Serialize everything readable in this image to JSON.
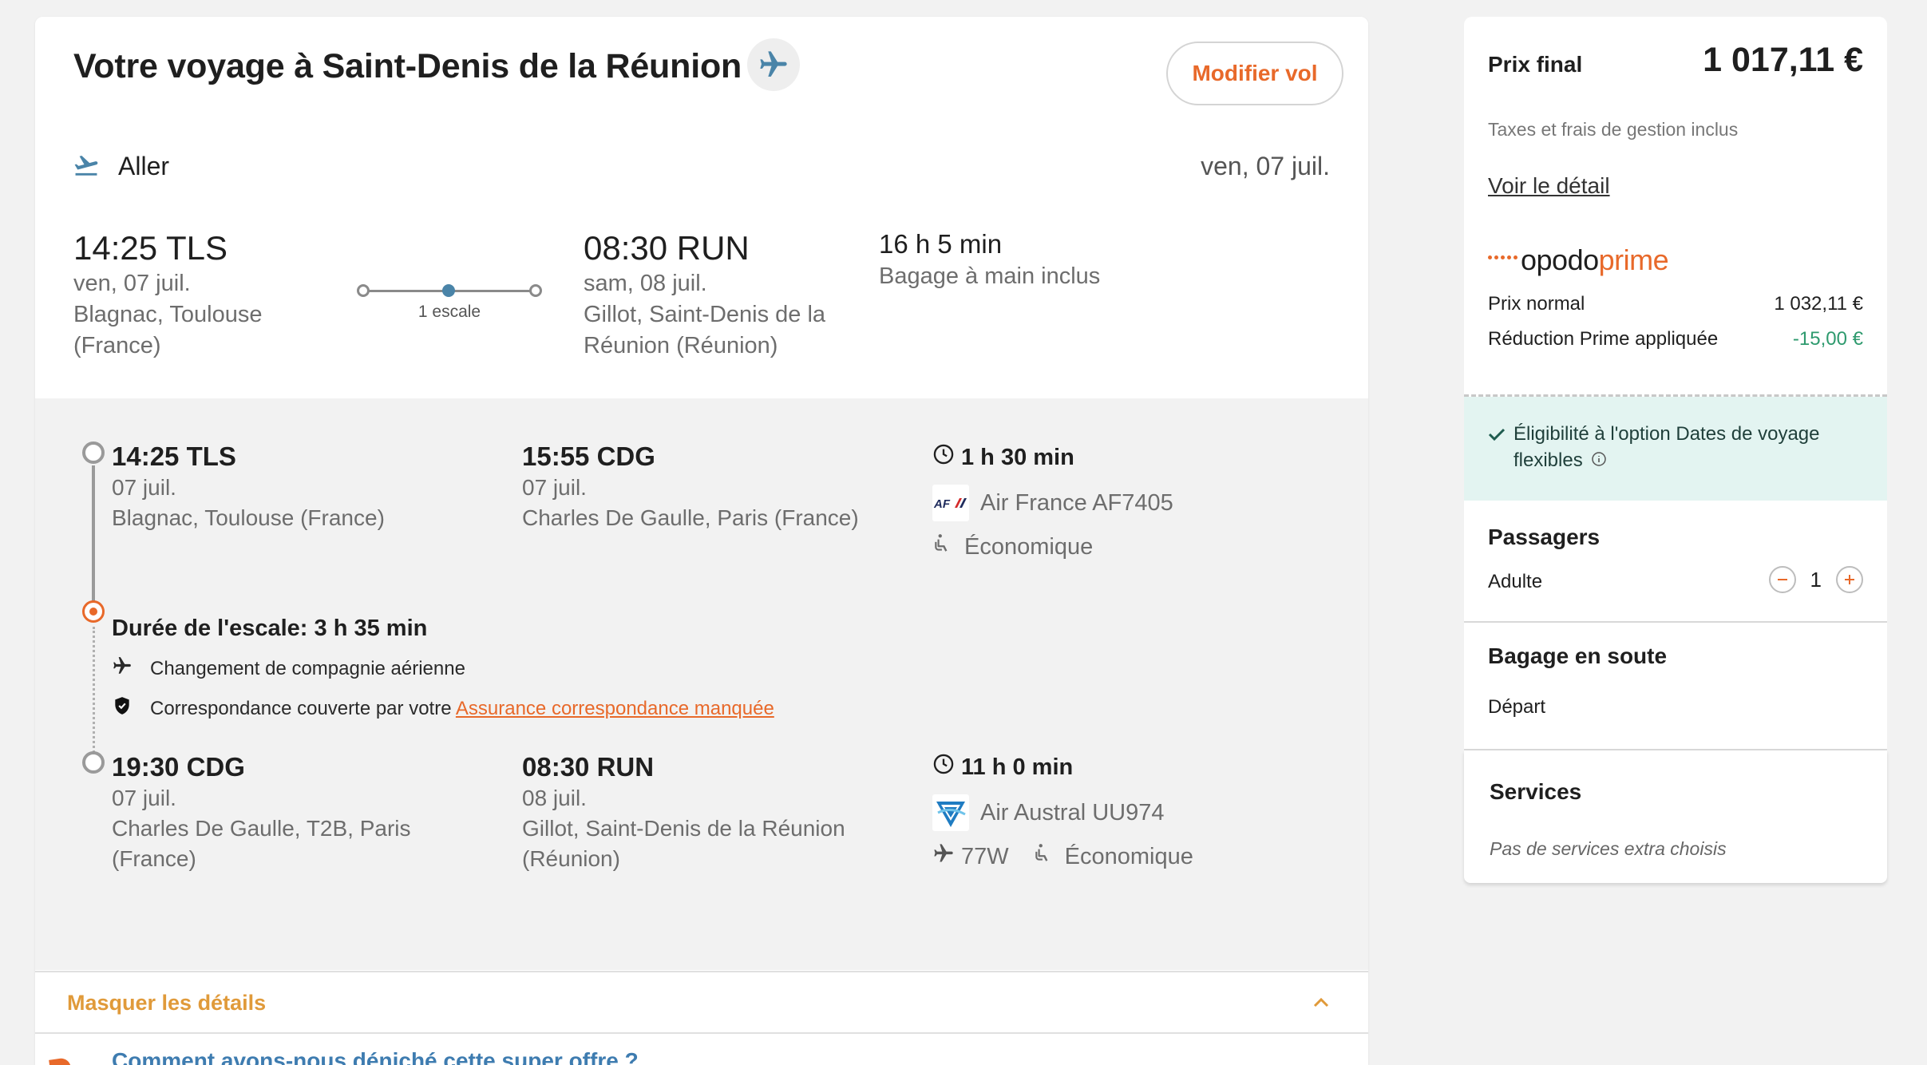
{
  "trip": {
    "title": "Votre voyage à Saint-Denis de la Réunion",
    "modify_label": "Modifier vol",
    "direction_label": "Aller",
    "direction_date": "ven, 07 juil.",
    "summary": {
      "departure": {
        "time_code": "14:25 TLS",
        "date": "ven, 07 juil.",
        "place": "Blagnac, Toulouse (France)"
      },
      "arrival": {
        "time_code": "08:30 RUN",
        "date": "sam, 08 juil.",
        "place": "Gillot, Saint-Denis de la Réunion (Réunion)"
      },
      "stops_label": "1 escale",
      "duration": "16 h 5 min",
      "baggage": "Bagage à main inclus"
    }
  },
  "details": {
    "segment1": {
      "dep_time": "14:25 TLS",
      "dep_date": "07 juil.",
      "dep_place": "Blagnac, Toulouse (France)",
      "arr_time": "15:55 CDG",
      "arr_date": "07 juil.",
      "arr_place": "Charles De Gaulle, Paris (France)",
      "duration": "1 h 30 min",
      "airline": "Air France AF7405",
      "cabin": "Économique"
    },
    "layover": {
      "title": "Durée de l'escale: 3 h 35 min",
      "change_airline": "Changement de compagnie aérienne",
      "coverage_text": "Correspondance couverte par votre",
      "coverage_link": "Assurance correspondance manquée"
    },
    "segment2": {
      "dep_time": "19:30 CDG",
      "dep_date": "07 juil.",
      "dep_place": "Charles De Gaulle, T2B, Paris (France)",
      "arr_time": "08:30 RUN",
      "arr_date": "08 juil.",
      "arr_place": "Gillot, Saint-Denis de la Réunion (Réunion)",
      "duration": "11 h 0 min",
      "airline": "Air Austral UU974",
      "aircraft": "77W",
      "cabin": "Économique"
    },
    "hide_label": "Masquer les détails",
    "how_label": "Comment avons-nous déniché cette super offre ?"
  },
  "sidebar": {
    "final_price_label": "Prix final",
    "final_price": "1 017,11 €",
    "tax_note": "Taxes et frais de gestion inclus",
    "detail_link": "Voir le détail",
    "prime_brand": "opodo",
    "prime_word": "prime",
    "normal_price_label": "Prix normal",
    "normal_price": "1 032,11 €",
    "discount_label": "Réduction Prime appliquée",
    "discount": "-15,00 €",
    "eligibility": "Éligibilité à l'option Dates de voyage flexibles",
    "passengers_title": "Passagers",
    "adult_label": "Adulte",
    "adult_count": "1",
    "baggage_title": "Bagage en soute",
    "departure_label": "Départ",
    "services_title": "Services",
    "services_note": "Pas de services extra choisis"
  },
  "colors": {
    "accent_orange": "#e8692a",
    "prime_green": "#2e9a6e",
    "link_blue": "#3e7cb0",
    "eligibility_bg": "#e3f4f1"
  },
  "icons": [
    "airplane-icon",
    "takeoff-icon",
    "clock-icon",
    "seat-icon",
    "shield-check-icon",
    "chevron-up-icon",
    "info-icon",
    "minus-icon",
    "plus-icon",
    "checkmark-icon"
  ]
}
